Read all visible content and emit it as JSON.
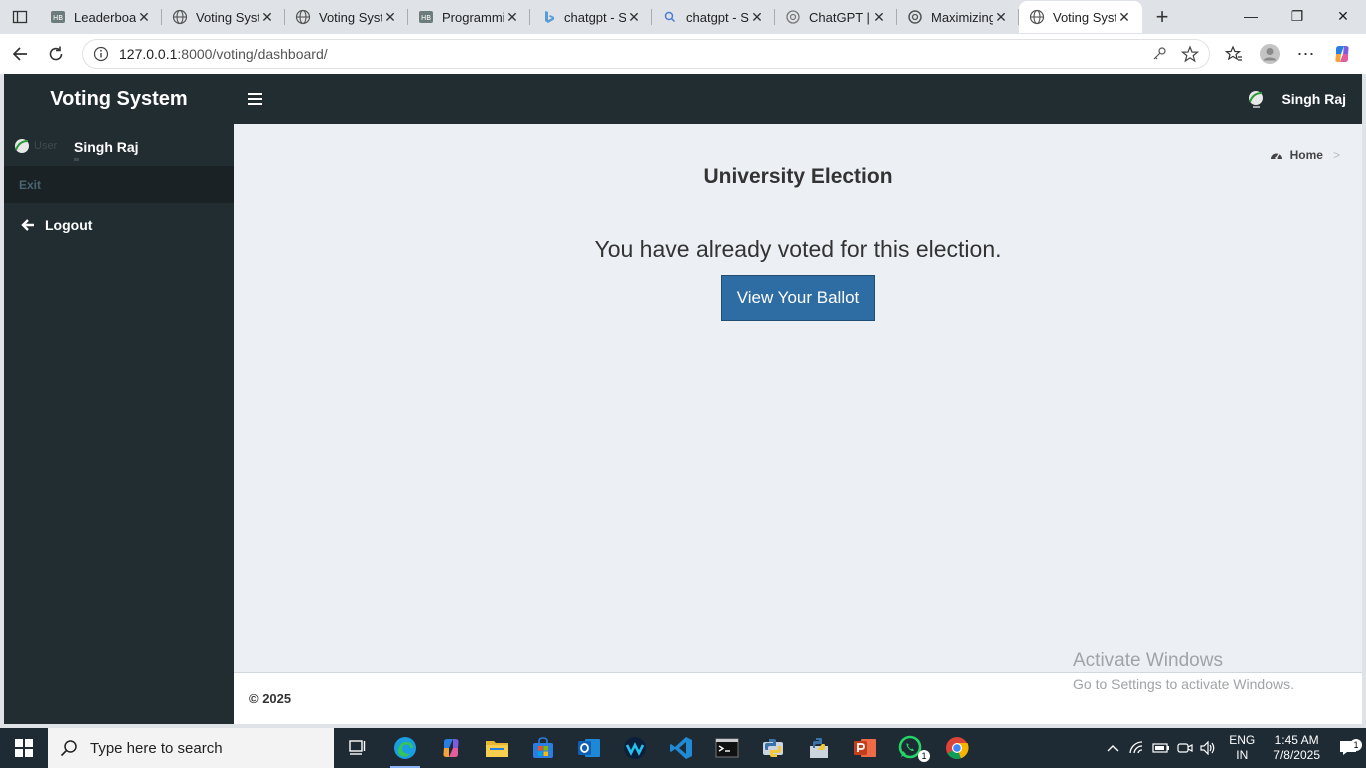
{
  "browser": {
    "tabs": [
      {
        "title": "Leaderboar",
        "icon": "hf-icon"
      },
      {
        "title": "Voting Syste",
        "icon": "globe-icon"
      },
      {
        "title": "Voting Syste",
        "icon": "globe-icon"
      },
      {
        "title": "Programmi",
        "icon": "hf-icon"
      },
      {
        "title": "chatgpt - Se",
        "icon": "bing-icon"
      },
      {
        "title": "chatgpt - Se",
        "icon": "search-icon"
      },
      {
        "title": "ChatGPT | C",
        "icon": "openai-icon"
      },
      {
        "title": "Maximizing",
        "icon": "openai-icon"
      },
      {
        "title": "Voting Syste",
        "icon": "globe-icon",
        "active": true
      }
    ],
    "url_host": "127.0.0.1",
    "url_rest": ":8000/voting/dashboard/"
  },
  "app": {
    "brand": "Voting System",
    "user_name": "Singh Raj",
    "avatar_alt": "User"
  },
  "sidebar": {
    "header": "Exit",
    "items": [
      {
        "label": "Logout",
        "icon": "arrow-left-icon"
      }
    ]
  },
  "main": {
    "breadcrumb_home": "Home",
    "breadcrumb_sep": ">",
    "title": "University Election",
    "message": "You have already voted for this election.",
    "button_label": "View Your Ballot"
  },
  "footer": {
    "copyright": "© 2025"
  },
  "watermark": {
    "line1": "Activate Windows",
    "line2": "Go to Settings to activate Windows."
  },
  "taskbar": {
    "search_placeholder": "Type here to search",
    "lang_line1": "ENG",
    "lang_line2": "IN",
    "time": "1:45 AM",
    "date": "7/8/2025",
    "whatsapp_badge": "1",
    "notification_badge": "1"
  },
  "colors": {
    "sidebar": "#222d32",
    "content_bg": "#ecf0f5",
    "primary_button": "#2e6da4"
  }
}
